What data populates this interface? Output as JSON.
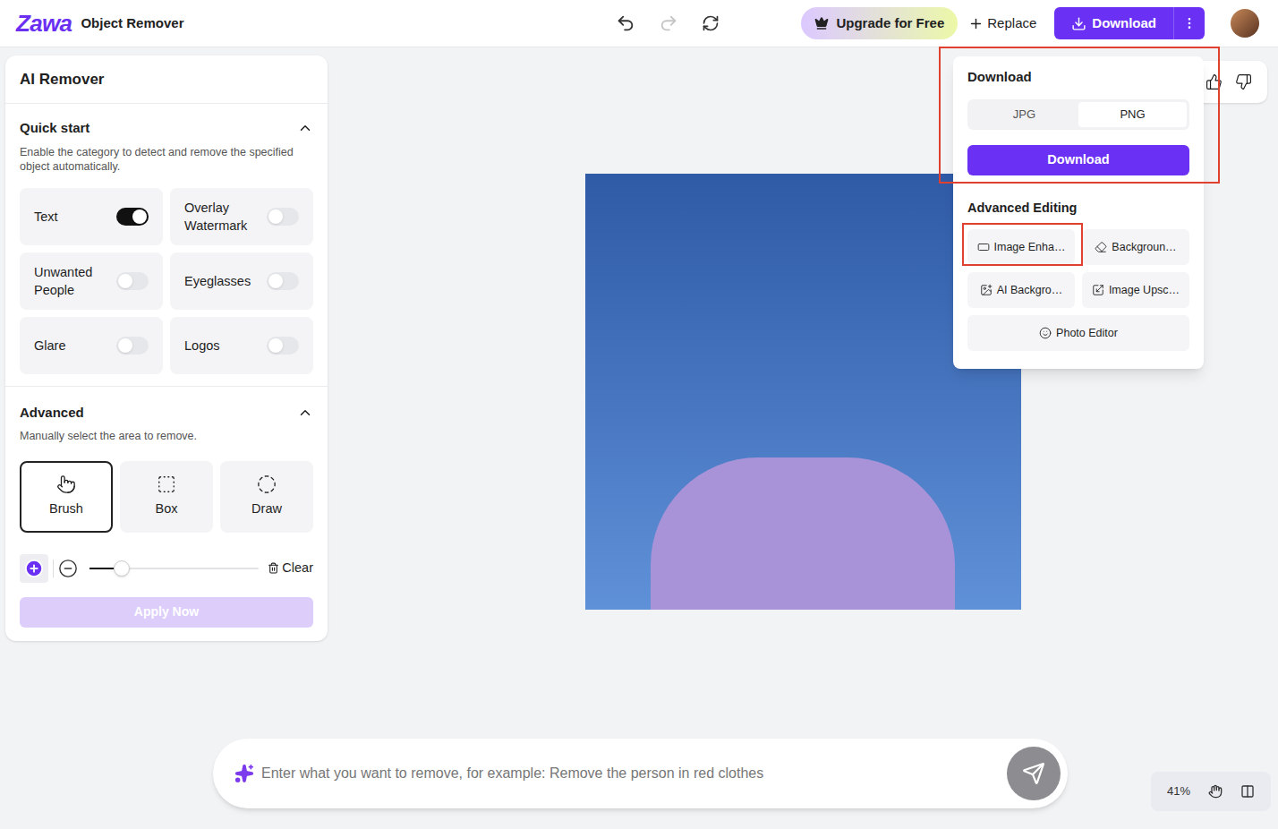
{
  "app": {
    "logo": "Zawa",
    "title": "Object Remover"
  },
  "toolbar": {
    "undo": {
      "disabled": false
    },
    "redo": {
      "disabled": true
    },
    "upgrade": "Upgrade for Free",
    "replace": "Replace",
    "download": "Download"
  },
  "panel": {
    "title": "AI Remover",
    "quick_start": {
      "title": "Quick start",
      "expanded": true,
      "description": "Enable the category to detect and remove the specified object automatically.",
      "toggles": [
        {
          "label": "Text",
          "on": true
        },
        {
          "label": "Overlay Watermark",
          "on": false
        },
        {
          "label": "Unwanted People",
          "on": false
        },
        {
          "label": "Eyeglasses",
          "on": false
        },
        {
          "label": "Glare",
          "on": false
        },
        {
          "label": "Logos",
          "on": false
        }
      ]
    },
    "advanced": {
      "title": "Advanced",
      "expanded": true,
      "description": "Manually select the area to remove.",
      "tools": [
        {
          "label": "Brush",
          "selected": true
        },
        {
          "label": "Box",
          "selected": false
        },
        {
          "label": "Draw",
          "selected": false
        }
      ],
      "brush_size": {
        "level": 0.19
      },
      "clear": "Clear",
      "apply": {
        "label": "Apply Now",
        "disabled": true
      }
    }
  },
  "download_menu": {
    "title": "Download",
    "formats": [
      {
        "label": "JPG",
        "selected": false
      },
      {
        "label": "PNG",
        "selected": true
      }
    ],
    "button": "Download",
    "advanced_title": "Advanced Editing",
    "tools": [
      {
        "label": "Image Enha…",
        "wide": false
      },
      {
        "label": "Backgroun…",
        "wide": false
      },
      {
        "label": "AI Backgro…",
        "wide": false
      },
      {
        "label": "Image Upsc…",
        "wide": false
      },
      {
        "label": "Photo Editor",
        "wide": true
      }
    ]
  },
  "annotations": [
    {
      "target": "download-section",
      "color": "#e0402f"
    },
    {
      "target": "image-enhancer",
      "color": "#e0402f"
    }
  ],
  "prompt": {
    "placeholder": "Enter what you want to remove, for example: Remove the person in red clothes"
  },
  "zoom": "41%"
}
